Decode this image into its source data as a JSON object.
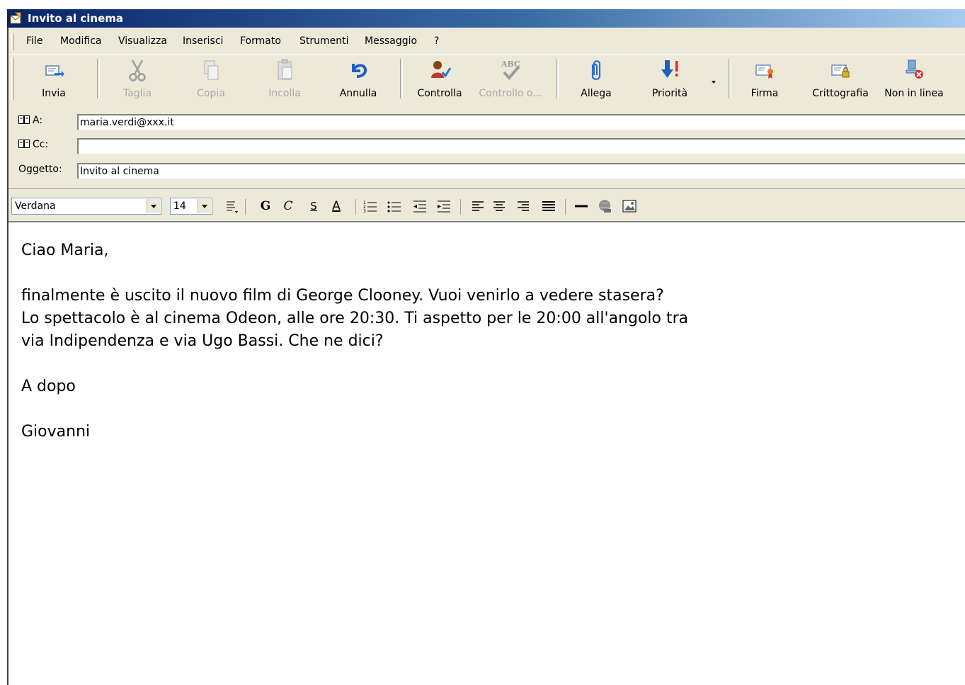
{
  "window": {
    "title": "Invito al cinema"
  },
  "menu": [
    "File",
    "Modifica",
    "Visualizza",
    "Inserisci",
    "Formato",
    "Strumenti",
    "Messaggio",
    "?"
  ],
  "toolbar": {
    "invia": "Invia",
    "taglia": "Taglia",
    "copia": "Copia",
    "incolla": "Incolla",
    "annulla": "Annulla",
    "controlla": "Controlla",
    "controllo_ortografia": "Controllo o...",
    "allega": "Allega",
    "priorita": "Priorità",
    "firma": "Firma",
    "crittografia": "Crittografia",
    "non_in_linea": "Non in linea"
  },
  "headers": {
    "to_label": "A:",
    "to_value": "maria.verdi@xxx.it",
    "cc_label": "Cc:",
    "cc_value": "",
    "subject_label": "Oggetto:",
    "subject_value": "Invito al cinema"
  },
  "format": {
    "font": "Verdana",
    "size": "14",
    "bold": "G",
    "italic": "C",
    "underline": "S",
    "font_color": "A"
  },
  "message": {
    "greeting": "Ciao Maria,",
    "line1": "finalmente è uscito il nuovo film di George Clooney. Vuoi venirlo a vedere stasera?",
    "line2": "Lo spettacolo è al cinema Odeon, alle ore 20:30. Ti aspetto per le 20:00 all'angolo tra",
    "line3": "via Indipendenza e via Ugo Bassi. Che ne dici?",
    "closing": "A dopo",
    "signature": "Giovanni"
  },
  "colors": {
    "title_gradient_start": "#0a246a",
    "title_gradient_end": "#a6caf0",
    "chrome": "#ece9d8"
  }
}
